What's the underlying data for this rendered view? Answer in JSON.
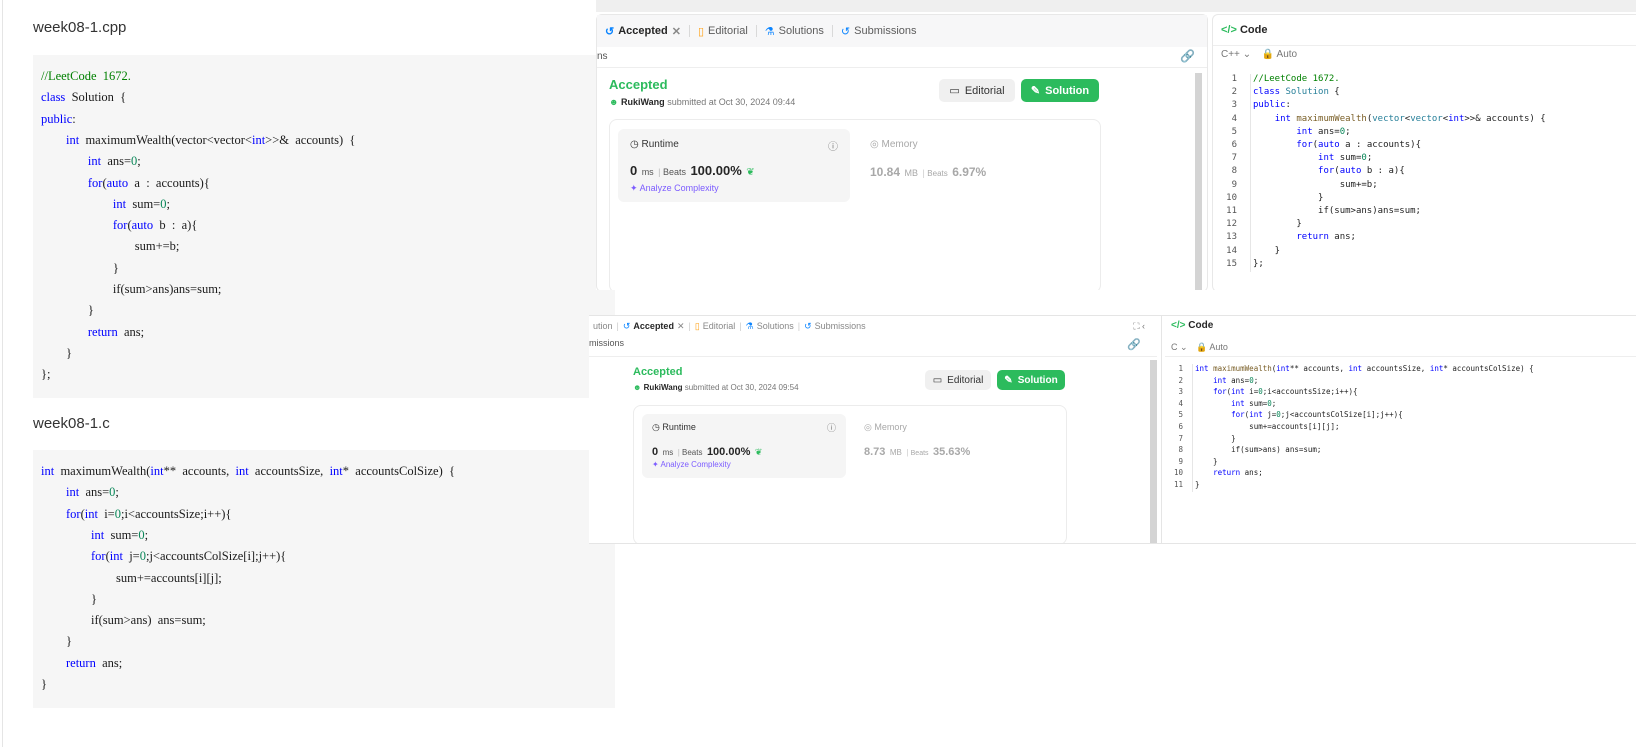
{
  "left": {
    "cpp_title": "week08-1.cpp",
    "c_title": "week08-1.c",
    "cpp_lines": [
      "//LeetCode  1672.",
      "class  Solution  {",
      "public:",
      "        int  maximumWealth(vector<vector<int>>&  accounts)  {",
      "               int  ans=0;",
      "               for(auto  a  :  accounts){",
      "                       int  sum=0;",
      "                       for(auto  b  :  a){",
      "                              sum+=b;",
      "                       }",
      "                       if(sum>ans)ans=sum;",
      "               }",
      "               return  ans;",
      "        }",
      "};"
    ],
    "c_lines": [
      "int  maximumWealth(int**  accounts,  int  accountsSize,  int*  accountsColSize)  {",
      "        int  ans=0;",
      "        for(int  i=0;i<accountsSize;i++){",
      "                int  sum=0;",
      "                for(int  j=0;j<accountsColSize[i];j++){",
      "                        sum+=accounts[i][j];",
      "                }",
      "                if(sum>ans)  ans=sum;",
      "        }",
      "        return  ans;",
      "}"
    ]
  },
  "top": {
    "tabs": {
      "accepted": "Accepted",
      "editorial": "Editorial",
      "solutions": "Solutions",
      "submissions": "Submissions"
    },
    "subbar_label": "ns",
    "status": "Accepted",
    "user": "RukiWang",
    "submitted": "submitted at Oct 30, 2024 09:44",
    "editorial_btn": "Editorial",
    "solution_btn": "Solution",
    "runtime_label": "Runtime",
    "runtime_value": "0",
    "runtime_unit": "ms",
    "runtime_beats_label": "Beats",
    "runtime_beats": "100.00%",
    "analyze": "Analyze Complexity",
    "memory_label": "Memory",
    "memory_value": "10.84",
    "memory_unit": "MB",
    "memory_beats_label": "Beats",
    "memory_beats": "6.97%",
    "code_title": "Code",
    "lang": "C++",
    "auto": "Auto",
    "code_lines": [
      "//LeetCode 1672.",
      "class Solution {",
      "public:",
      "    int maximumWealth(vector<vector<int>>& accounts) {",
      "        int ans=0;",
      "        for(auto a : accounts){",
      "            int sum=0;",
      "            for(auto b : a){",
      "                sum+=b;",
      "            }",
      "            if(sum>ans)ans=sum;",
      "        }",
      "        return ans;",
      "    }",
      "};"
    ]
  },
  "bottom": {
    "tabs": {
      "solution_partial": "ution",
      "accepted": "Accepted",
      "editorial": "Editorial",
      "solutions": "Solutions",
      "submissions": "Submissions"
    },
    "subbar_label": "missions",
    "status": "Accepted",
    "user": "RukiWang",
    "submitted": "submitted at Oct 30, 2024 09:54",
    "editorial_btn": "Editorial",
    "solution_btn": "Solution",
    "runtime_label": "Runtime",
    "runtime_value": "0",
    "runtime_unit": "ms",
    "runtime_beats_label": "Beats",
    "runtime_beats": "100.00%",
    "analyze": "Analyze Complexity",
    "memory_label": "Memory",
    "memory_value": "8.73",
    "memory_unit": "MB",
    "memory_beats_label": "Beats",
    "memory_beats": "35.63%",
    "code_title": "Code",
    "lang": "C",
    "auto": "Auto",
    "code_lines": [
      "int maximumWealth(int** accounts, int accountsSize, int* accountsColSize) {",
      "    int ans=0;",
      "    for(int i=0;i<accountsSize;i++){",
      "        int sum=0;",
      "        for(int j=0;j<accountsColSize[i];j++){",
      "            sum+=accounts[i][j];",
      "        }",
      "        if(sum>ans) ans=sum;",
      "    }",
      "    return ans;",
      "}"
    ]
  },
  "colors": {
    "accent_green": "#2cbb5d",
    "keyword_blue": "#0000ff",
    "number_green": "#098658",
    "comment_green": "#008000"
  }
}
